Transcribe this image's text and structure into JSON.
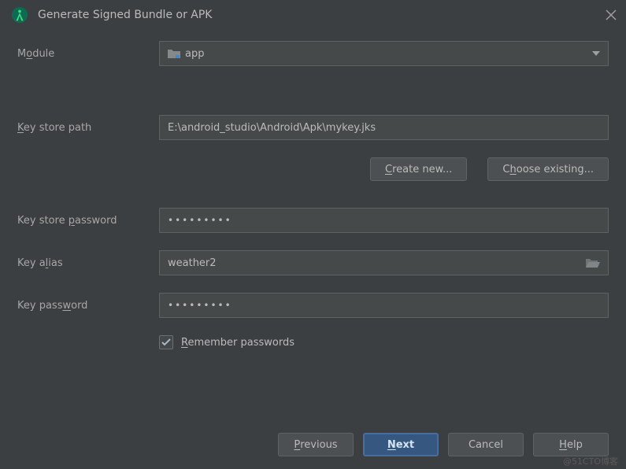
{
  "window": {
    "title": "Generate Signed Bundle or APK"
  },
  "labels": {
    "module_pre": "M",
    "module_mne": "o",
    "module_post": "dule",
    "keystore_mne": "K",
    "keystore_post": "ey store path",
    "kspass_pre": "Key store ",
    "kspass_mne": "p",
    "kspass_post": "assword",
    "alias_pre": "Key a",
    "alias_mne": "l",
    "alias_post": "ias",
    "keypass_pre": "Key pass",
    "keypass_mne": "w",
    "keypass_post": "ord",
    "remember_mne": "R",
    "remember_post": "emember passwords"
  },
  "values": {
    "module": "app",
    "keystore_path": "E:\\android_studio\\Android\\Apk\\mykey.jks",
    "keystore_password_mask": "•••••••••",
    "alias": "weather2",
    "key_password_mask": "•••••••••",
    "remember_checked": true
  },
  "buttons": {
    "create_mne": "C",
    "create_post": "reate new...",
    "choose_pre": "C",
    "choose_mne": "h",
    "choose_post": "oose existing...",
    "prev_mne": "P",
    "prev_post": "revious",
    "next_mne": "N",
    "next_post": "ext",
    "cancel": "Cancel",
    "help_mne": "H",
    "help_post": "elp"
  },
  "watermark": "@51CTO博客"
}
